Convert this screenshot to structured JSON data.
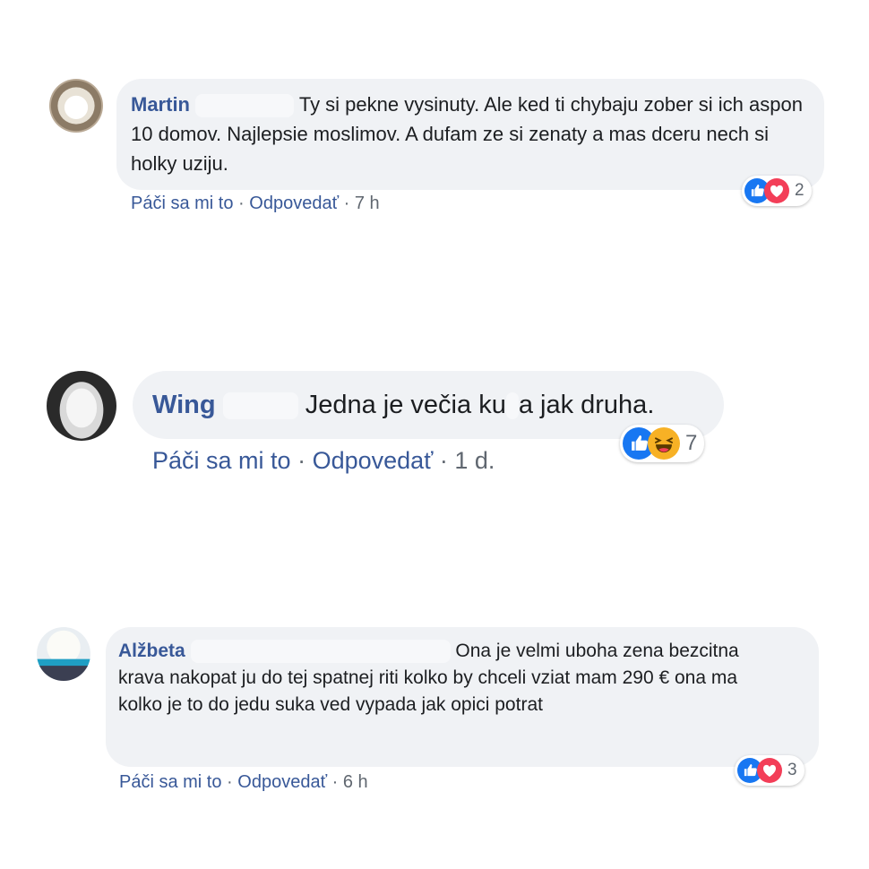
{
  "colors": {
    "author": "#385898",
    "bubble": "#f0f2f5",
    "meta": "#606770",
    "like": "#1877f2",
    "love": "#f33e58",
    "haha": "#f7b125"
  },
  "comments": [
    {
      "author": "Martin",
      "text": "Ty si pekne vysinuty. Ale ked ti chybaju zober si ich aspon 10 domov. Najlepsie moslimov. A dufam ze si zenaty a mas dceru nech si holky uziju.",
      "like_label": "Páči sa mi to",
      "reply_label": "Odpovedať",
      "time": "7 h",
      "reactions": [
        "like-icon",
        "love-icon"
      ],
      "reaction_count": "2"
    },
    {
      "author": "Wing",
      "text_before": "Jedna je večia ku",
      "text_after": "a jak druha.",
      "like_label": "Páči sa mi to",
      "reply_label": "Odpovedať",
      "time": "1 d.",
      "reactions": [
        "like-icon",
        "haha-icon"
      ],
      "reaction_count": "7"
    },
    {
      "author": "Alžbeta",
      "text": "Ona je velmi uboha zena bezcitna krava nakopat ju do tej spatnej riti kolko by chceli vziat mam 290 € ona ma kolko je to do jedu suka ved vypada jak opici potrat",
      "like_label": "Páči sa mi to",
      "reply_label": "Odpovedať",
      "time": "6 h",
      "reactions": [
        "like-icon",
        "love-icon"
      ],
      "reaction_count": "3"
    }
  ],
  "separator": "·"
}
